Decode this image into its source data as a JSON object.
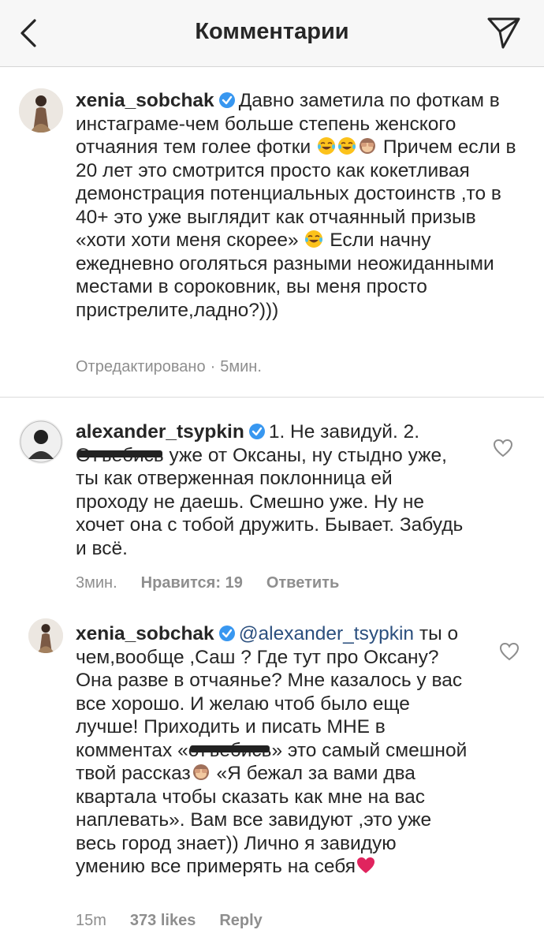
{
  "header": {
    "title": "Комментарии",
    "back_icon": "chevron-left-icon",
    "send_icon": "paper-plane-icon"
  },
  "comments": [
    {
      "username": "xenia_sobchak",
      "verified": true,
      "text_1": "Давно заметила по фоткам в инстаграме-чем больше степень женского отчаяния тем голее фотки",
      "text_2": "Причем если в 20 лет это смотрится просто как кокетливая демонстрация потенциальных достоинств ,то в 40+ это уже выглядит как отчаянный призыв «хоти хоти меня скорее»",
      "text_3": "Если начну ежедневно оголяться разными неожиданными местами в сороковник, вы меня просто пристрелите,ладно?)))",
      "edited": "Отредактировано",
      "separator": "·",
      "time": "5мин."
    },
    {
      "username": "alexander_tsypkin",
      "verified": true,
      "text_1": "1. Не завидуй. 2.",
      "redacted_word": "Отъебись",
      "text_2": "уже от Оксаны, ну стыдно уже, ты как отверженная поклонница ей проходу не даешь. Смешно уже. Ну не хочет она с тобой дружить. Бывает. Забудь и всё.",
      "time": "3мин.",
      "likes": "Нравится: 19",
      "reply": "Ответить"
    },
    {
      "username": "xenia_sobchak",
      "verified": true,
      "mention": "@alexander_tsypkin",
      "text_1": "ты о чем,вообще ,Саш ? Где тут про Оксану? Она разве в отчаянье? Мне казалось у вас все хорошо. И желаю чтоб было еще лучше! Приходить и писать МНЕ в комментах «",
      "redacted_word": "отъебись",
      "text_2": "» это самый смешной твой рассказ",
      "text_3": "«Я бежал за вами два квартала чтобы сказать как мне на вас наплевать». Вам все завидуют ,это уже весь город знает)) Лично я завидую умению все примерять на себя",
      "time": "15m",
      "likes": "373 likes",
      "reply": "Reply"
    }
  ],
  "colors": {
    "text": "#262626",
    "meta": "#8e8e8e",
    "verified": "#3897f0",
    "mention": "#2b4f7e",
    "heart": "#e0245e"
  }
}
